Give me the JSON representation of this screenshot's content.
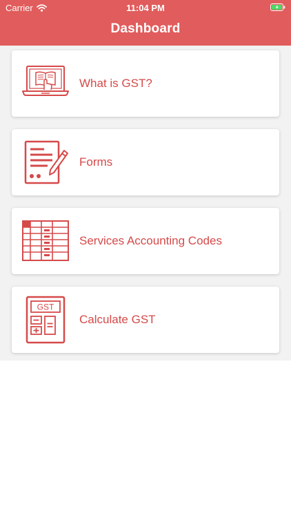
{
  "status_bar": {
    "carrier": "Carrier",
    "time": "11:04 PM"
  },
  "header": {
    "title": "Dashboard",
    "background_color": "#e15c5c"
  },
  "accent_color": "#d64949",
  "menu": [
    {
      "label": "What is GST?",
      "icon": "laptop-book-icon"
    },
    {
      "label": "Forms",
      "icon": "form-pen-icon"
    },
    {
      "label": "Services Accounting Codes",
      "icon": "table-grid-icon"
    },
    {
      "label": "Calculate GST",
      "icon": "calculator-icon"
    }
  ],
  "calculator_display": "GST"
}
